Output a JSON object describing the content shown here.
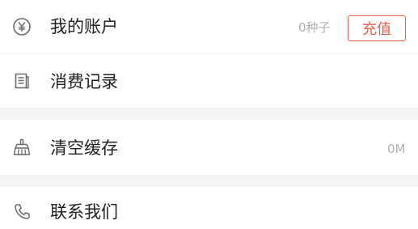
{
  "menu": {
    "account": {
      "label": "我的账户",
      "balance": "0种子",
      "recharge_label": "充值",
      "icon": "yen-coin-icon"
    },
    "history": {
      "label": "消费记录",
      "icon": "receipt-icon"
    },
    "cache": {
      "label": "清空缓存",
      "size": "0M",
      "icon": "broom-icon"
    },
    "contact": {
      "label": "联系我们",
      "icon": "phone-icon"
    }
  },
  "colors": {
    "accent": "#e2614d",
    "separator": "#f4f4f4",
    "muted_text": "#b0b0b0"
  }
}
